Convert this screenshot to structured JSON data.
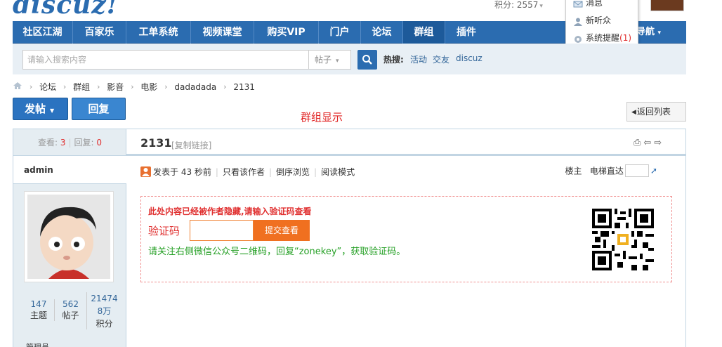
{
  "header": {
    "logo_text": "discuz!",
    "points_text": "积分: 2557",
    "caret": "▾"
  },
  "nav": {
    "items": [
      {
        "label": "社区江湖"
      },
      {
        "label": "百家乐"
      },
      {
        "label": "工单系统"
      },
      {
        "label": "视频课堂"
      },
      {
        "label": "购买VIP"
      },
      {
        "label": "门户"
      },
      {
        "label": "论坛"
      },
      {
        "label": "群组",
        "active": true
      },
      {
        "label": "插件"
      }
    ],
    "dropdown_label": "导航",
    "dropdown_caret": "▾"
  },
  "user_menu": {
    "items": [
      {
        "label": "消息",
        "icon": "envelope-icon"
      },
      {
        "label": "新听众",
        "icon": "person-icon"
      },
      {
        "label": "系统提醒",
        "icon": "gear-icon",
        "count": "(1)"
      }
    ]
  },
  "search": {
    "placeholder": "请输入搜索内容",
    "type_value": "帖子",
    "hot_label": "热搜:",
    "hot_links": [
      "活动",
      "交友",
      "discuz"
    ]
  },
  "breadcrumb": {
    "items": [
      "论坛",
      "群组",
      "影音",
      "电影",
      "dadadada",
      "2131"
    ],
    "separator": "›"
  },
  "actions": {
    "post_label": "发帖",
    "reply_label": "回复",
    "group_display": "群组显示",
    "back_label": "返回列表",
    "back_icon": "◀"
  },
  "thread": {
    "views_label": "查看:",
    "views": "3",
    "replies_label": "回复:",
    "replies": "0",
    "title": "2131",
    "copy_link": "[复制链接]",
    "title_icons": "⎙⇦⇨"
  },
  "author": {
    "name": "admin",
    "stats": [
      {
        "value": "147",
        "label": "主题"
      },
      {
        "value": "562",
        "label": "帖子"
      },
      {
        "value": "214748万",
        "label": "积分"
      }
    ],
    "rank": "管理员"
  },
  "post_meta": {
    "posted": "发表于 43 秒前",
    "only_author": "只看该作者",
    "reverse": "倒序浏览",
    "read_mode": "阅读模式",
    "floor_owner": "楼主",
    "elevator": "电梯直达",
    "go_icon": "➚"
  },
  "hidden": {
    "title": "此处内容已经被作者隐藏,请输入验证码查看",
    "code_label": "验证码",
    "input_value": "",
    "submit_label": "提交查看",
    "note": "请关注右侧微信公众号二维码，回复“zonekey”，获取验证码。"
  },
  "colors": {
    "nav_blue": "#2b6cb0",
    "alert_red": "#e03030",
    "note_green": "#26a026",
    "submit_orange": "#f07020"
  }
}
